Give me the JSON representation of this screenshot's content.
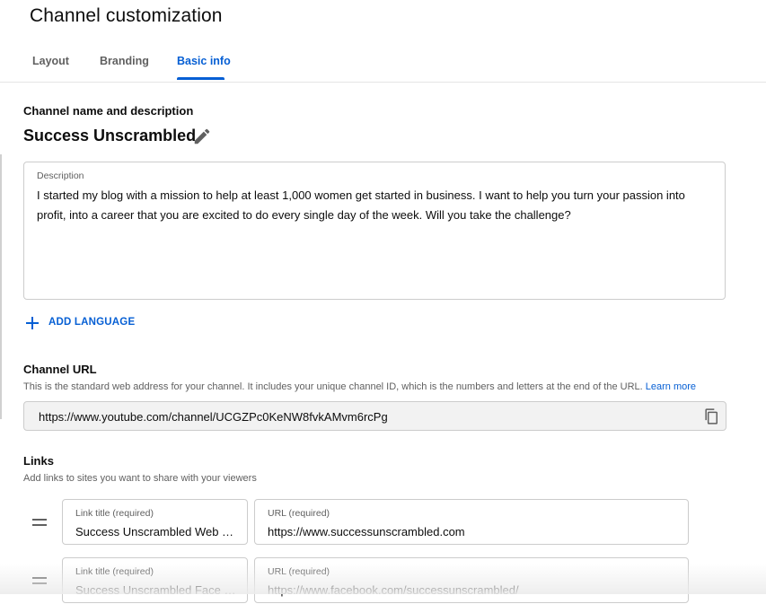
{
  "page": {
    "title": "Channel customization"
  },
  "tabs": [
    {
      "label": "Layout",
      "active": false
    },
    {
      "label": "Branding",
      "active": false
    },
    {
      "label": "Basic info",
      "active": true
    }
  ],
  "basic_info": {
    "name_section_label": "Channel name and description",
    "channel_name": "Success Unscrambled",
    "description": {
      "label": "Description",
      "value": "I started my blog with a mission to help at least 1,000 women get started in business. I want to help you turn your passion into profit, into a career that you are excited to do every single day of the week. Will you take the challenge?"
    },
    "add_language_label": "ADD LANGUAGE",
    "channel_url": {
      "label": "Channel URL",
      "helper": "This is the standard web address for your channel. It includes your unique channel ID, which is the numbers and letters at the end of the URL.",
      "learn_more": "Learn more",
      "value": "https://www.youtube.com/channel/UCGZPc0KeNW8fvkAMvm6rcPg"
    },
    "links": {
      "label": "Links",
      "helper": "Add links to sites you want to share with your viewers",
      "items": [
        {
          "title_label": "Link title (required)",
          "title_value": "Success Unscrambled Web …",
          "url_label": "URL (required)",
          "url_value": "https://www.successunscrambled.com"
        },
        {
          "title_label": "Link title (required)",
          "title_value": "Success Unscrambled Face …",
          "url_label": "URL (required)",
          "url_value": "https://www.facebook.com/successunscrambled/"
        }
      ]
    }
  },
  "icons": {
    "edit": "pencil-icon",
    "add": "plus-icon",
    "copy": "copy-icon",
    "drag": "drag-handle-icon"
  },
  "colors": {
    "accent": "#065fd4",
    "text": "#0d0d0d",
    "secondary_text": "#606060",
    "border": "#cccccc"
  }
}
